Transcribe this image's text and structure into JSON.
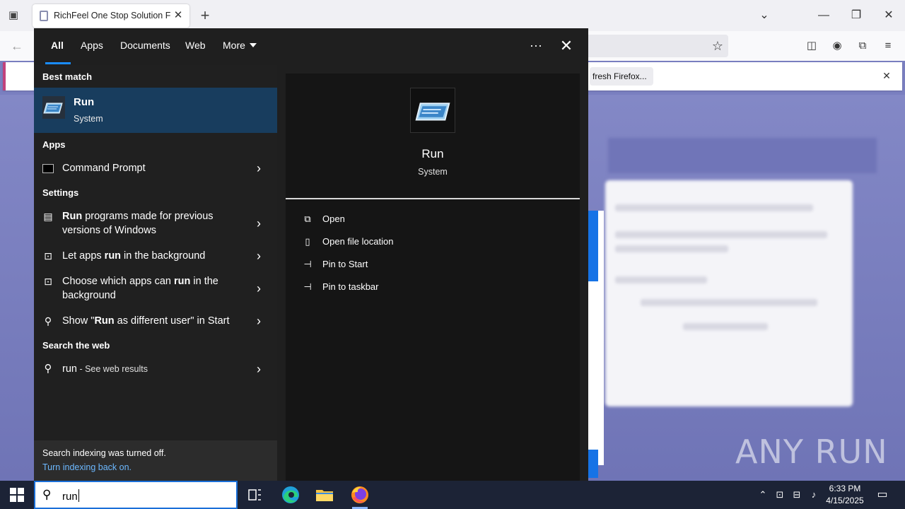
{
  "browser": {
    "tab_title": "RichFeel One Stop Solution For",
    "tab_close": "✕",
    "new_tab": "+",
    "notification_button": "fresh Firefox...",
    "notification_close": "✕"
  },
  "search_panel": {
    "filters": [
      {
        "label": "All"
      },
      {
        "label": "Apps"
      },
      {
        "label": "Documents"
      },
      {
        "label": "Web"
      },
      {
        "label": "More"
      }
    ],
    "dots": "···",
    "close": "✕",
    "sections": {
      "best_match": "Best match",
      "apps": "Apps",
      "settings": "Settings",
      "search_web": "Search the web"
    },
    "best_match": {
      "title": "Run",
      "subtitle": "System"
    },
    "apps": [
      {
        "label": "Command Prompt"
      }
    ],
    "settings": [
      {
        "bold": "Run",
        "rest": " programs made for previous versions of Windows"
      },
      {
        "pre": "Let apps ",
        "bold": "run",
        "rest": " in the background"
      },
      {
        "pre": "Choose which apps can ",
        "bold": "run",
        "rest": " in the background"
      },
      {
        "pre": "Show \"",
        "bold": "Run",
        "rest": " as different user\" in Start"
      }
    ],
    "web": {
      "query": "run",
      "suffix": " - See web results"
    },
    "indexing": {
      "text": "Search indexing was turned off.",
      "link": "Turn indexing back on."
    },
    "preview": {
      "title": "Run",
      "subtitle": "System",
      "actions": [
        {
          "label": "Open",
          "icon": "open-icon"
        },
        {
          "label": "Open file location",
          "icon": "file-location-icon"
        },
        {
          "label": "Pin to Start",
          "icon": "pin-icon"
        },
        {
          "label": "Pin to taskbar",
          "icon": "pin-icon"
        }
      ]
    }
  },
  "taskbar": {
    "search_value": "run",
    "time": "6:33 PM",
    "date": "4/15/2025"
  },
  "watermark": "ANY RUN",
  "colors": {
    "accent": "#1a8cff",
    "best_match_bg": "#183d5e",
    "taskbar_bg": "#1c2336"
  }
}
